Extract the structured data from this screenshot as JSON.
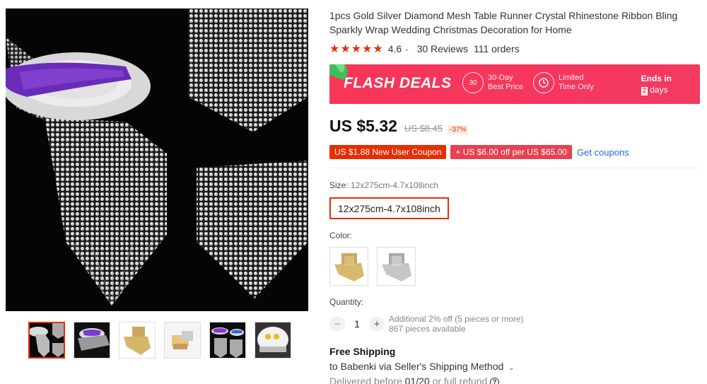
{
  "product": {
    "title": "1pcs Gold Silver Diamond Mesh Table Runner Crystal Rhinestone Ribbon Bling Sparkly Wrap Wedding Christmas Decoration for Home",
    "stars": "★★★★★",
    "rating": "4.6",
    "rating_chevron": "⌄",
    "reviews": "30 Reviews",
    "orders": "111 orders"
  },
  "flash": {
    "title": "FLASH DEALS",
    "best_price_icon": "30",
    "best_price_line1": "30-Day",
    "best_price_line2": "Best Price",
    "limited_icon": "clock-icon",
    "limited_line1": "Limited",
    "limited_line2": "Time Only",
    "ends_label": "Ends in",
    "ends_days_num": "2",
    "ends_days_text": "days"
  },
  "price": {
    "current": "US $5.32",
    "original": "US $8.45",
    "discount": "-37%"
  },
  "coupons": {
    "new_user": "US $1.88 New User Coupon",
    "store": "+ US $6.00 off per US $65.00",
    "get_link": "Get coupons"
  },
  "size": {
    "label": "Size:",
    "selected_value": "12x275cm-4.7x108inch",
    "option": "12x275cm-4.7x108inch"
  },
  "color": {
    "label": "Color:",
    "options": [
      "gold",
      "silver"
    ]
  },
  "quantity": {
    "label": "Quantity:",
    "minus": "−",
    "value": "1",
    "plus": "+",
    "note1": "Additional 2% off (5 pieces or more)",
    "note2": "867 pieces available"
  },
  "shipping": {
    "title": "Free Shipping",
    "to": "to Babenki via Seller's Shipping Method",
    "delivered_prefix": "Delivered before",
    "delivered_date": "01/20",
    "delivered_suffix": "or full refund",
    "help_icon": "?"
  },
  "colors": {
    "accent": "#e62e04",
    "flash_bg": "#f73658",
    "link": "#1d6bd9"
  }
}
